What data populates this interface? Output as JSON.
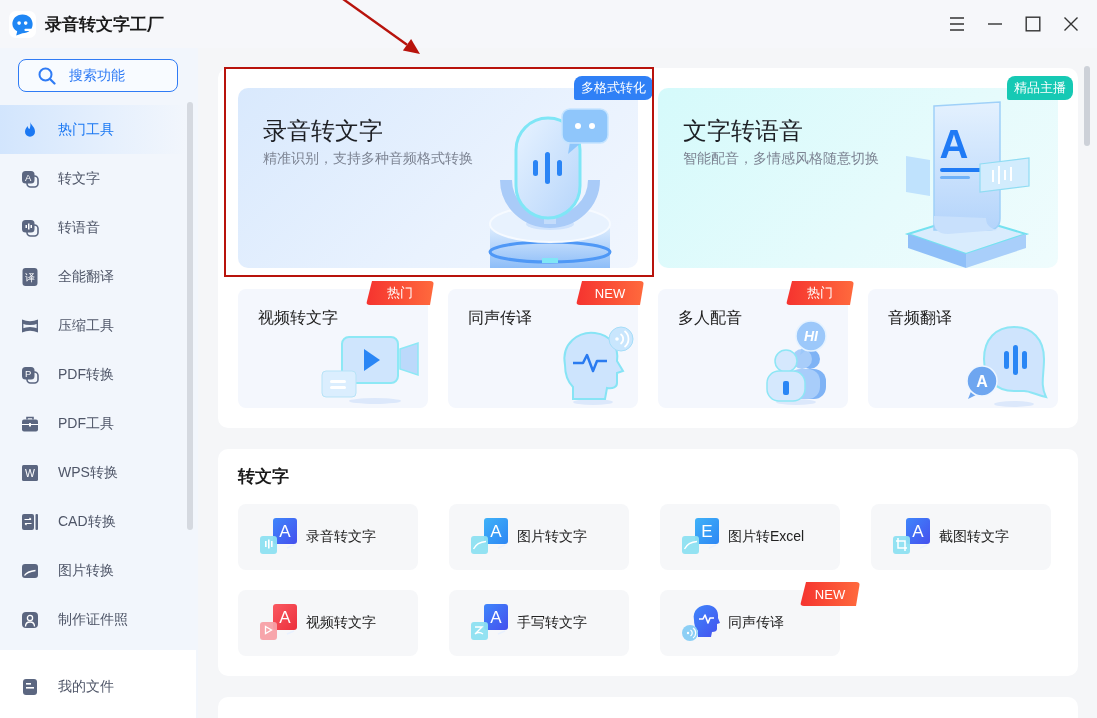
{
  "window": {
    "title": "录音转文字工厂"
  },
  "sidebar": {
    "search": {
      "label": "搜索功能"
    },
    "items": [
      {
        "label": "热门工具",
        "selected": true
      },
      {
        "label": "转文字",
        "selected": false,
        "glyph": "A"
      },
      {
        "label": "转语音",
        "selected": false
      },
      {
        "label": "全能翻译",
        "selected": false,
        "glyph": "译"
      },
      {
        "label": "压缩工具",
        "selected": false
      },
      {
        "label": "PDF转换",
        "selected": false,
        "glyph": "P"
      },
      {
        "label": "PDF工具",
        "selected": false
      },
      {
        "label": "WPS转换",
        "selected": false,
        "glyph": "W"
      },
      {
        "label": "CAD转换",
        "selected": false
      },
      {
        "label": "图片转换",
        "selected": false
      },
      {
        "label": "制作证件照",
        "selected": false
      }
    ],
    "footer": {
      "label": "我的文件"
    }
  },
  "hot_tools": {
    "featured": [
      {
        "title": "录音转文字",
        "subtitle": "精准识别，支持多种音频格式转换",
        "badge": {
          "text": "多格式转化",
          "color": "#2f80f6"
        },
        "highlighted": true
      },
      {
        "title": "文字转语音",
        "subtitle": "智能配音，多情感风格随意切换",
        "badge": {
          "text": "精品主播",
          "color": "#16c9b4"
        },
        "glyph": "A",
        "highlighted": false
      }
    ],
    "tools": [
      {
        "title": "视频转文字",
        "badge": "热门"
      },
      {
        "title": "同声传译",
        "badge": "NEW"
      },
      {
        "title": "多人配音",
        "badge": "热门",
        "glyph": "HI"
      },
      {
        "title": "音频翻译",
        "glyph": "A"
      }
    ]
  },
  "sections": [
    {
      "title": "转文字",
      "tools": [
        {
          "label": "录音转文字",
          "glyph": "A"
        },
        {
          "label": "图片转文字",
          "glyph": "A"
        },
        {
          "label": "图片转Excel",
          "glyph": "E"
        },
        {
          "label": "截图转文字",
          "glyph": "A"
        },
        {
          "label": "视频转文字",
          "glyph": "A"
        },
        {
          "label": "手写转文字",
          "glyph": "A"
        },
        {
          "label": "同声传译",
          "badge": "NEW"
        }
      ]
    }
  ]
}
